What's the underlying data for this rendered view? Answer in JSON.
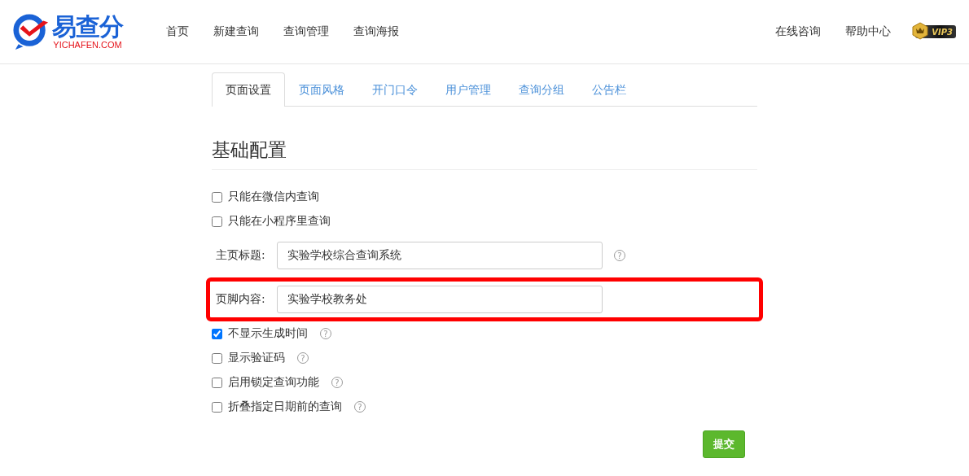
{
  "header": {
    "logo": {
      "name": "易查分",
      "domain": "YICHAFEN.COM"
    },
    "nav": [
      {
        "label": "首页"
      },
      {
        "label": "新建查询"
      },
      {
        "label": "查询管理"
      },
      {
        "label": "查询海报"
      }
    ],
    "right_nav": [
      {
        "label": "在线咨询"
      },
      {
        "label": "帮助中心"
      }
    ],
    "vip_badge": "VIP3"
  },
  "tabs": [
    {
      "label": "页面设置",
      "selected": true
    },
    {
      "label": "页面风格",
      "selected": false
    },
    {
      "label": "开门口令",
      "selected": false
    },
    {
      "label": "用户管理",
      "selected": false
    },
    {
      "label": "查询分组",
      "selected": false
    },
    {
      "label": "公告栏",
      "selected": false
    }
  ],
  "section_title": "基础配置",
  "settings": [
    {
      "kind": "checkbox",
      "label": "只能在微信内查询",
      "checked": false
    },
    {
      "kind": "checkbox",
      "label": "只能在小程序里查询",
      "checked": false
    },
    {
      "kind": "field",
      "label": "主页标题:",
      "value": "实验学校综合查询系统",
      "help": "?",
      "highlighted": false
    },
    {
      "kind": "field",
      "label": "页脚内容:",
      "value": "实验学校教务处",
      "highlighted": true
    },
    {
      "kind": "checkbox",
      "label": "不显示生成时间",
      "checked": true,
      "help": "?"
    },
    {
      "kind": "checkbox",
      "label": "显示验证码",
      "checked": false,
      "help": "?"
    },
    {
      "kind": "checkbox",
      "label": "启用锁定查询功能",
      "checked": false,
      "help": "?"
    },
    {
      "kind": "checkbox",
      "label": "折叠指定日期前的查询",
      "checked": false,
      "help": "?"
    }
  ],
  "submit_button": "提交"
}
